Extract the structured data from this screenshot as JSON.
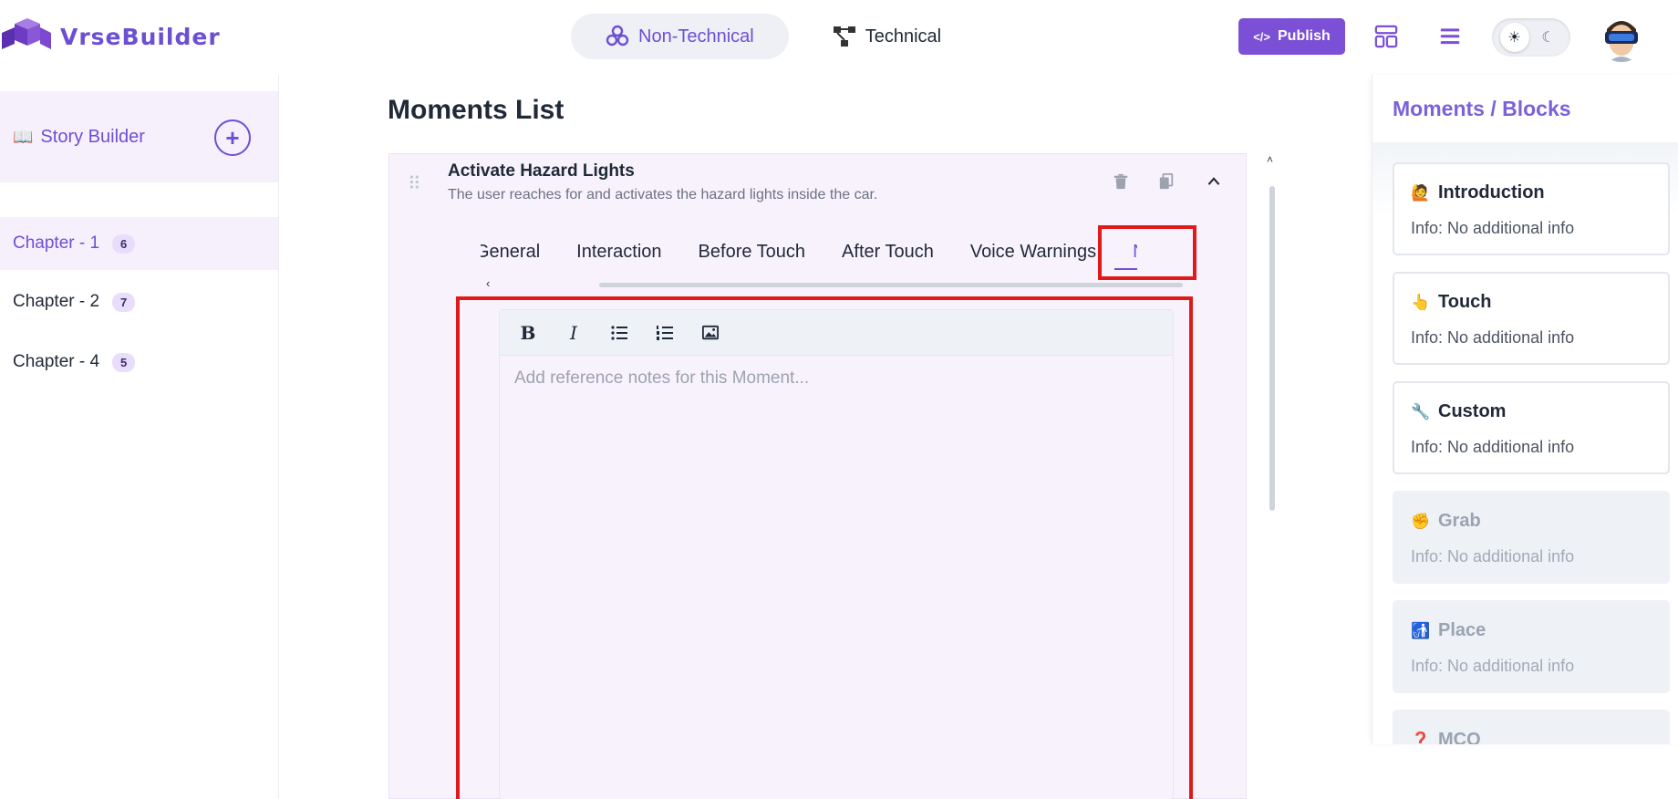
{
  "app": {
    "name": "VrseBuilder"
  },
  "header": {
    "mode_non_technical": "Non-Technical",
    "mode_technical": "Technical",
    "publish_label": "Publish"
  },
  "sidebar": {
    "story_title": "Story Builder",
    "chapters": [
      {
        "label": "Chapter - 1",
        "count": "6"
      },
      {
        "label": "Chapter - 2",
        "count": "7"
      },
      {
        "label": "Chapter - 4",
        "count": "5"
      }
    ]
  },
  "main": {
    "title": "Moments List",
    "moment": {
      "title": "Activate Hazard Lights",
      "description": "The user reaches for and activates the hazard lights inside the car."
    },
    "tabs": [
      "General",
      "Interaction",
      "Before Touch",
      "After Touch",
      "Voice Warnings",
      "Notes"
    ],
    "active_tab": "Notes",
    "editor": {
      "placeholder": "Add reference notes for this Moment..."
    }
  },
  "right_panel": {
    "title": "Moments / Blocks",
    "blocks": [
      {
        "name": "Introduction",
        "info": "Info: No additional info",
        "icon": "🙋"
      },
      {
        "name": "Touch",
        "info": "Info: No additional info",
        "icon": "👆"
      },
      {
        "name": "Custom",
        "info": "Info: No additional info",
        "icon": "🔧"
      },
      {
        "name": "Grab",
        "info": "Info: No additional info",
        "icon": "✊"
      },
      {
        "name": "Place",
        "info": "Info: No additional info",
        "icon": "🚮"
      },
      {
        "name": "MCQ",
        "info": "",
        "icon": "❓"
      }
    ]
  },
  "colors": {
    "accent": "#6d4fd3",
    "highlight": "#e01a1a"
  }
}
